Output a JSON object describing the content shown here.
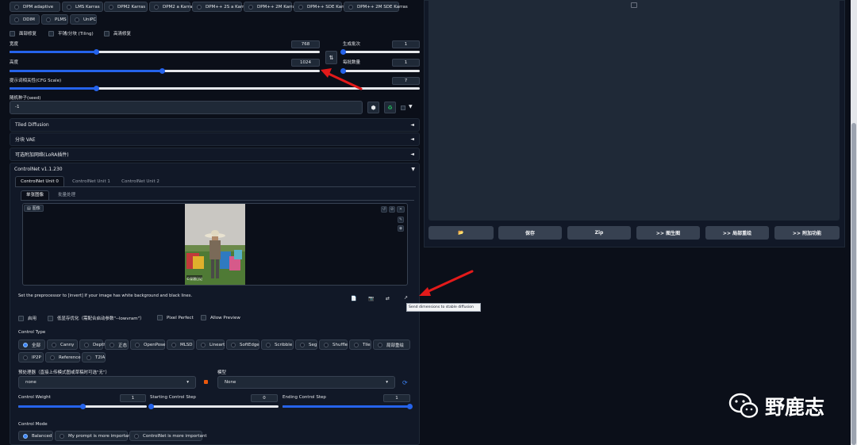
{
  "samplers_row1": [
    "DPM adaptive",
    "LMS Karras",
    "DPM2 Karras",
    "DPM2 a Karras",
    "DPM++ 2S a Karras",
    "DPM++ 2M Karras",
    "DPM++ SDE Karras",
    "DPM++ 2M SDE Karras"
  ],
  "samplers_row2": [
    "DDIM",
    "PLMS",
    "UniPC"
  ],
  "options": {
    "restore_faces": "面部修复",
    "tiling": "平铺/分块 (Tiling)",
    "hires": "高清修复"
  },
  "width": {
    "label": "宽度",
    "value": "768",
    "fraction": 0.28
  },
  "height": {
    "label": "高度",
    "value": "1024",
    "fraction": 0.49
  },
  "swap_icon": "⇅",
  "batch_count": {
    "label": "生成批次",
    "value": "1",
    "fraction": 0.0
  },
  "batch_size": {
    "label": "每批数量",
    "value": "1",
    "fraction": 0.0
  },
  "cfg": {
    "label": "提示词相关性(CFG Scale)",
    "value": "7",
    "fraction": 0.21
  },
  "seed": {
    "label": "随机种子(seed)",
    "value": "-1"
  },
  "accordions": {
    "tiled_diffusion": "Tiled Diffusion",
    "tiled_vae": "分块 VAE",
    "lora": "可选附加网络(LoRA插件)",
    "controlnet": "ControlNet v1.1.230"
  },
  "arrow_collapsed": "◄",
  "arrow_expanded": "▼",
  "cn_tabs": [
    "ControlNet Unit 0",
    "ControlNet Unit 1",
    "ControlNet Unit 2"
  ],
  "sub_tabs": [
    "单张图像",
    "批量处理"
  ],
  "image_label": "图像",
  "photo_caption": "©深潜日记",
  "hint": "Set the preprocessor to [invert] If your image has white background and black lines.",
  "tooltip": "Send dimensions to stable diffusion",
  "cn_checks": {
    "enable": "启用",
    "lowvram": "低显存优化（需配合启动参数\"--lowvram\"）",
    "pixel_perfect": "Pixel Perfect",
    "allow_preview": "Allow Preview"
  },
  "control_type_label": "Control Type",
  "control_types_row1": [
    "全部",
    "Canny",
    "Depth",
    "正态",
    "OpenPose",
    "MLSD",
    "Lineart",
    "SoftEdge",
    "Scribble",
    "Seg",
    "Shuffle",
    "Tile",
    "局部重绘"
  ],
  "control_types_row2": [
    "IP2P",
    "Reference",
    "T2IA"
  ],
  "preprocessor": {
    "label": "预处理器（直接上传模式图或草稿时可选\"无\"）",
    "value": "none"
  },
  "model": {
    "label": "模型",
    "value": "None"
  },
  "control_weight": {
    "label": "Control Weight",
    "value": "1",
    "fraction": 0.5
  },
  "start_step": {
    "label": "Starting Control Step",
    "value": "0",
    "fraction": 0.0
  },
  "end_step": {
    "label": "Ending Control Step",
    "value": "1",
    "fraction": 1.0
  },
  "control_mode_label": "Control Mode",
  "control_modes": [
    "Balanced",
    "My prompt is more important",
    "ControlNet is more important"
  ],
  "output_buttons": [
    "📂",
    "保存",
    "Zip",
    ">> 图生图",
    ">> 局部重绘",
    ">> 附加功能"
  ],
  "watermark": "野鹿志",
  "colors": {
    "accent": "#2563eb",
    "arrow": "#e31a1a",
    "bg": "#0b0f19"
  }
}
